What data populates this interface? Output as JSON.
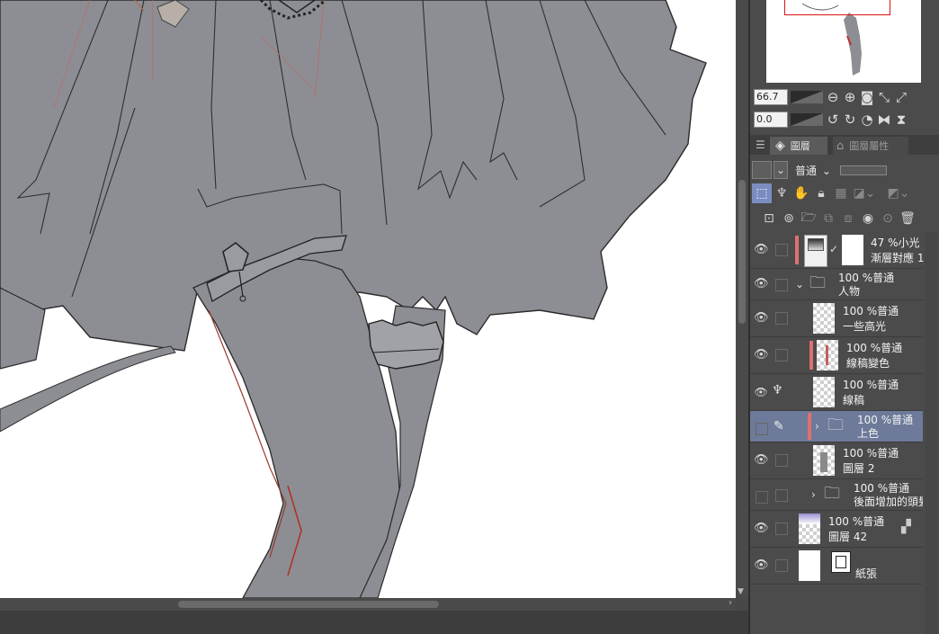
{
  "navigator": {
    "zoom_value": "66.7",
    "rotation_value": "0.0"
  },
  "tabs": {
    "layer_tab": "圖層",
    "property_tab": "圖層屬性"
  },
  "layer_toolbar": {
    "blend_mode": "普通"
  },
  "layers": [
    {
      "opacity_mode": "47 %小光",
      "name": "漸層對應 1"
    },
    {
      "opacity_mode": "100 %普通",
      "name": "人物"
    },
    {
      "opacity_mode": "100 %普通",
      "name": "一些高光"
    },
    {
      "opacity_mode": "100 %普通",
      "name": "線稿變色"
    },
    {
      "opacity_mode": "100 %普通",
      "name": "線稿"
    },
    {
      "opacity_mode": "100 %普通",
      "name": "上色"
    },
    {
      "opacity_mode": "100 %普通",
      "name": "圖層 2"
    },
    {
      "opacity_mode": "100 %普通",
      "name": "後面增加的頭髮"
    },
    {
      "opacity_mode": "100 %普通",
      "name": "圖層 42"
    },
    {
      "opacity_mode": "",
      "name": "紙張"
    }
  ],
  "colors": {
    "panel_bg": "#4b4b4b",
    "selected_layer": "#6d7a99",
    "active_tool": "#7b8cc0",
    "layer_red_mark": "#e07070",
    "artwork_gray": "#8d8e94"
  }
}
